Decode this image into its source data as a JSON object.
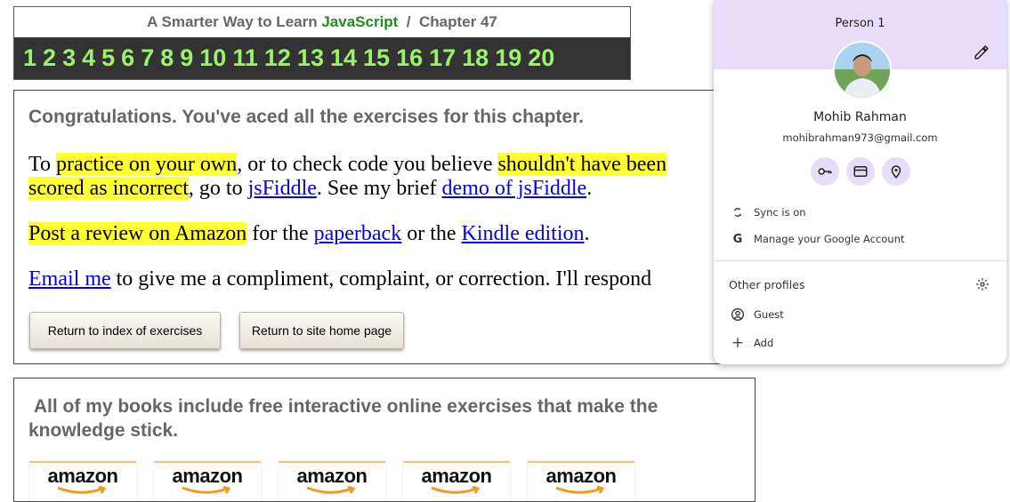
{
  "header": {
    "prefix": "A Smarter Way to Learn",
    "brand": "JavaScript",
    "separator": "/",
    "chapter": "Chapter 47",
    "chapters": [
      "1",
      "2",
      "3",
      "4",
      "5",
      "6",
      "7",
      "8",
      "9",
      "10",
      "11",
      "12",
      "13",
      "14",
      "15",
      "16",
      "17",
      "18",
      "19",
      "20"
    ]
  },
  "congrats": {
    "heading": "Congratulations. You've aced all the exercises for this chapter.",
    "p1": {
      "t1": "To ",
      "h1": "practice on your own",
      "t2": ", or to check code you believe ",
      "h2a": "shouldn't have been",
      "h2b": "scored as incorrect",
      "t3": ", go to ",
      "link1": "jsFiddle",
      "t4": ". See my brief ",
      "link2": "demo of jsFiddle",
      "t5": "."
    },
    "p2": {
      "h": "Post a review on Amazon",
      "t1": " for the ",
      "link1": "paperback",
      "t2": " or the ",
      "link2": "Kindle edition",
      "t3": "."
    },
    "p3": {
      "link": "Email me",
      "t1": " to give me a compliment, complaint, or correction. I'll respond"
    },
    "buttons": {
      "index": "Return to index of exercises",
      "home": "Return to site home page"
    }
  },
  "books": {
    "text": "All of my books include free interactive online exercises that make the knowledge stick.",
    "logos": [
      "amazon",
      "amazon",
      "amazon",
      "amazon",
      "amazon"
    ]
  },
  "profile": {
    "title": "Person 1",
    "name": "Mohib Rahman",
    "email": "mohibrahman973@gmail.com",
    "quick_icons": [
      "key-icon",
      "credit-card-icon",
      "location-pin-icon"
    ],
    "sync": "Sync is on",
    "manage": "Manage your Google Account",
    "other_profiles": "Other profiles",
    "guest": "Guest",
    "add": "Add",
    "accent": "#e8dcfb"
  }
}
